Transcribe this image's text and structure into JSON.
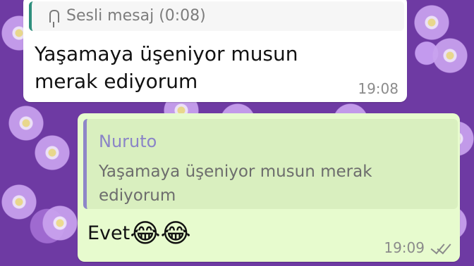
{
  "incoming": {
    "reply_label": "Sesli mesaj (0:08)",
    "message": "Yaşamaya üşeniyor musun merak ediyorum",
    "time": "19:08"
  },
  "outgoing": {
    "quote_name": "Nuruto",
    "quote_text": "Yaşamaya üşeniyor musun merak ediyorum",
    "message": "Evet",
    "emoji": "😂😂",
    "time": "19:09"
  },
  "colors": {
    "incoming_bubble": "#ffffff",
    "outgoing_bubble": "#e7fbce",
    "reply_bar": "#2f8f7d",
    "quote_bar": "#8e86c8"
  }
}
